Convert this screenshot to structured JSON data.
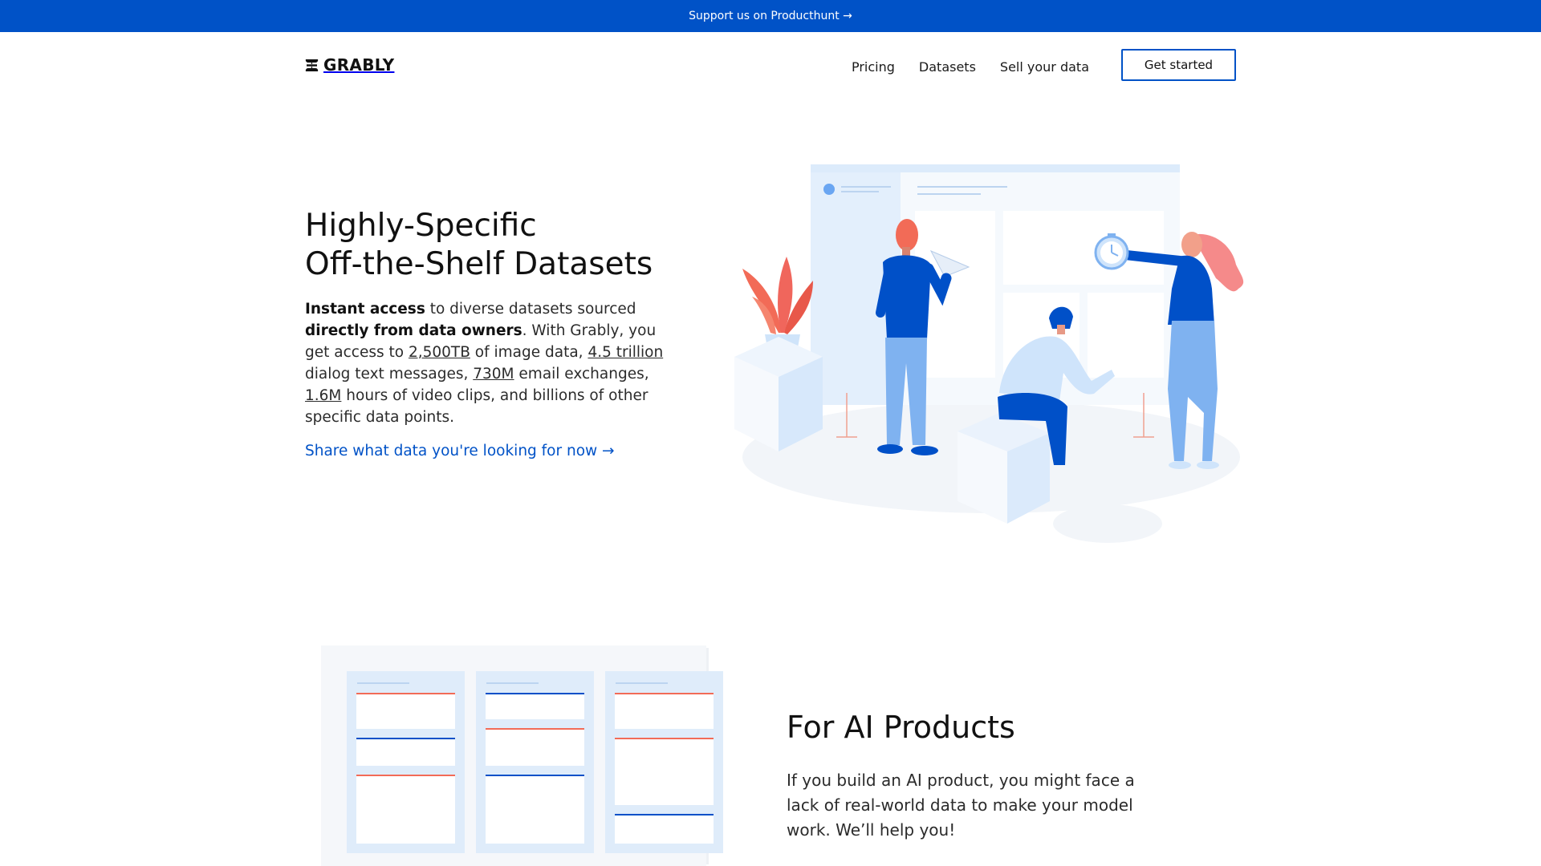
{
  "topbar": {
    "text": "Support us on Producthunt →"
  },
  "brand": {
    "name": "GRABLY",
    "color": "#0052c7"
  },
  "nav": {
    "links": [
      "Pricing",
      "Datasets",
      "Sell your data"
    ],
    "cta": "Get started"
  },
  "hero": {
    "title_line1": "Highly-Specific",
    "title_line2": "Off-the-Shelf Datasets",
    "desc": {
      "bold1": "Instant access",
      "t1": " to diverse datasets sourced ",
      "bold2": "directly from data owners",
      "t2": ". With Grably, you get access to ",
      "stat1": "2,500TB",
      "t3": " of image data, ",
      "stat2": "4.5 trillion",
      "t4": " dialog text messages, ",
      "stat3": "730M",
      "t5": " email exchanges, ",
      "stat4": "1.6M",
      "t6": " hours of video clips, and billions of other specific data points."
    },
    "cta": "Share what data you're looking for now →"
  },
  "ai_section": {
    "title": "For AI Products",
    "desc": "If you build an AI product, you might face a lack of real-world data to make your model work. We’ll help you!"
  },
  "icons": [
    "grably-logo-icon",
    "paper-plane-icon",
    "stopwatch-icon",
    "plant-icon"
  ]
}
